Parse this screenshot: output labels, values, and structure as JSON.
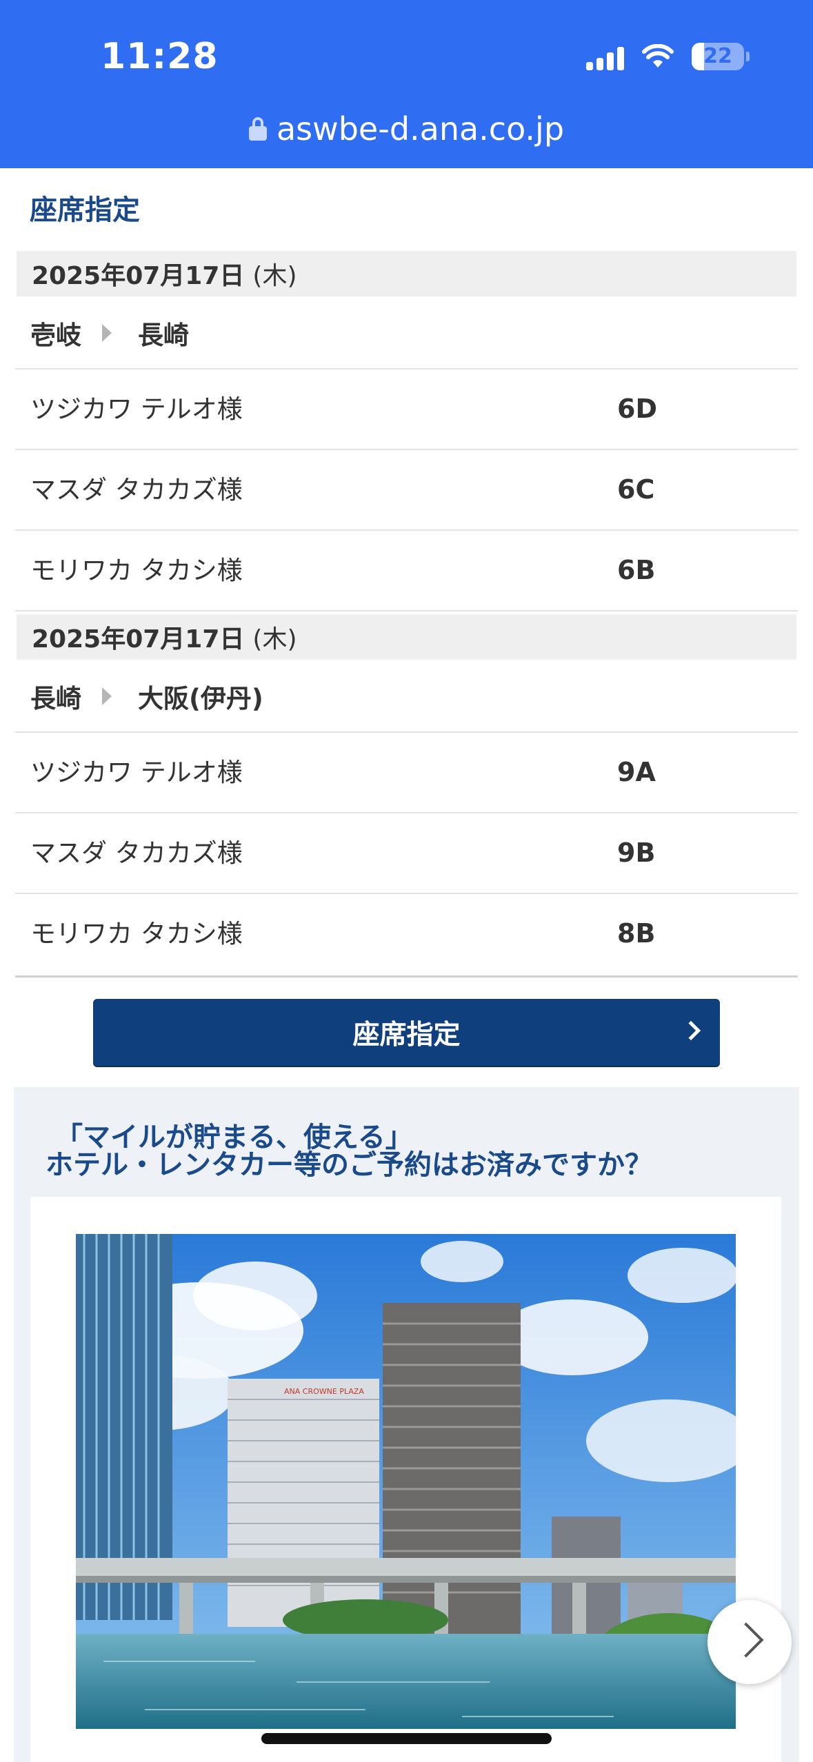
{
  "status_bar": {
    "time": "11:28",
    "battery": "22"
  },
  "url_bar": {
    "url": "aswbe-d.ana.co.jp"
  },
  "page_title": "座席指定",
  "segments": [
    {
      "date": "2025年07月17日",
      "weekday": "(木)",
      "from": "壱岐",
      "to": "長崎",
      "passengers": [
        {
          "name": "ツジカワ テルオ様",
          "seat": "6D"
        },
        {
          "name": "マスダ タカカズ様",
          "seat": "6C"
        },
        {
          "name": "モリワカ タカシ様",
          "seat": "6B"
        }
      ]
    },
    {
      "date": "2025年07月17日",
      "weekday": "(木)",
      "from": "長崎",
      "to": "大阪(伊丹)",
      "passengers": [
        {
          "name": "ツジカワ テルオ様",
          "seat": "9A"
        },
        {
          "name": "マスダ タカカズ様",
          "seat": "9B"
        },
        {
          "name": "モリワカ タカシ様",
          "seat": "8B"
        }
      ]
    }
  ],
  "seat_button": {
    "label": "座席指定"
  },
  "promo": {
    "line1": "「マイルが貯まる、使える」",
    "line2": "ホテル・レンタカー等のご予約はお済みですか？",
    "hotel_sign": "ANA CROWNE PLAZA"
  },
  "colors": {
    "status_bar": "#2f6df2",
    "heading": "#1a4a8a",
    "button": "#0f3f7c",
    "promo_bg": "#eef2f7"
  }
}
